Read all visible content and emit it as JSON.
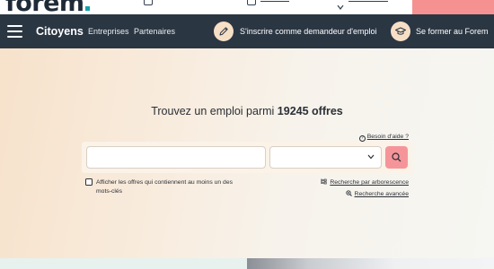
{
  "brand": {
    "logo_text": "forem",
    "accent": "#12a3a8"
  },
  "nav": {
    "main": "Citoyens",
    "links": [
      "Entreprises",
      "Partenaires"
    ],
    "cta_register": "S'inscrire comme demandeur d'emploi",
    "cta_training": "Se former au Forem",
    "register_icon": "pencil-icon",
    "training_icon": "graduation-cap-icon",
    "background": "#2b3643"
  },
  "hero": {
    "title_prefix": "Trouvez un emploi parmi ",
    "offer_count": "19245 offres",
    "help_link": "Besoin d'aide ?",
    "keyword_placeholder": "",
    "location_value": "",
    "search_icon": "search-icon",
    "search_button_color": "#f5959a",
    "checkbox_label": "Afficher les offres qui contiennent au moins un des mots-clés",
    "checkbox_checked": false,
    "tree_search_link": "Recherche par arborescence",
    "advanced_search_link": "Recherche avancée"
  }
}
